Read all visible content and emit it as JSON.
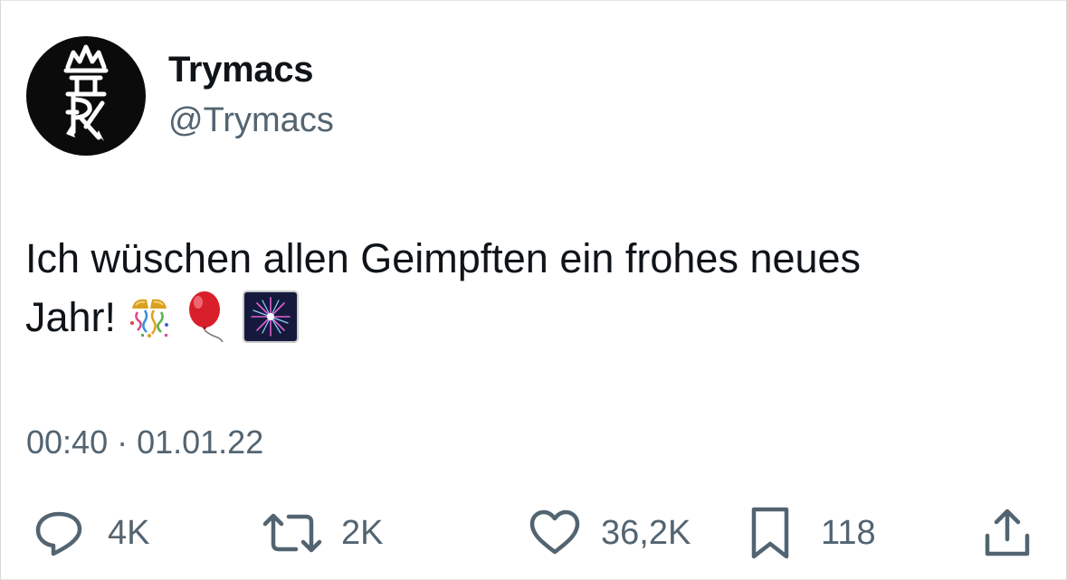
{
  "author": {
    "display_name": "Trymacs",
    "handle": "@Trymacs",
    "avatar_icon": "crown-monogram-avatar"
  },
  "tweet": {
    "line1": "Ich wüschen allen Geimpften ein frohes neues",
    "line2": "Jahr!",
    "emojis": [
      "confetti-ball-icon",
      "balloon-icon",
      "fireworks-icon"
    ]
  },
  "meta": {
    "timestamp": "00:40 · 01.01.22"
  },
  "actions": {
    "replies": "4K",
    "retweets": "2K",
    "likes": "36,2K",
    "bookmarks": "118"
  },
  "colors": {
    "text": "#0f1419",
    "secondary": "#536471",
    "avatar_bg": "#0b0b0b"
  }
}
